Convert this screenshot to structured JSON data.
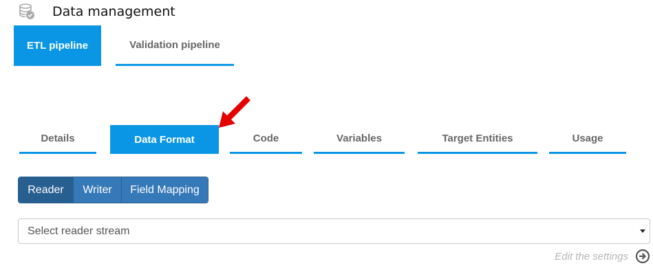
{
  "header": {
    "title": "Data management",
    "icon": "database-check-icon"
  },
  "top_tabs": [
    {
      "label": "ETL pipeline",
      "active": true
    },
    {
      "label": "Validation pipeline",
      "active": false
    }
  ],
  "sub_tabs": [
    {
      "label": "Details",
      "active": false
    },
    {
      "label": "Data Format",
      "active": true
    },
    {
      "label": "Code",
      "active": false
    },
    {
      "label": "Variables",
      "active": false
    },
    {
      "label": "Target Entities",
      "active": false
    },
    {
      "label": "Usage",
      "active": false
    }
  ],
  "annotation": {
    "icon": "red-arrow-icon",
    "color": "#e60000"
  },
  "button_group": [
    {
      "label": "Reader",
      "active": true
    },
    {
      "label": "Writer",
      "active": false
    },
    {
      "label": "Field Mapping",
      "active": false
    }
  ],
  "reader_select": {
    "value": "Select reader stream"
  },
  "edit_settings": {
    "label": "Edit the settings",
    "icon": "arrow-circle-right-icon"
  },
  "colors": {
    "accent": "#0b96e5",
    "button": "#3579b8",
    "button_active": "#285f91"
  }
}
